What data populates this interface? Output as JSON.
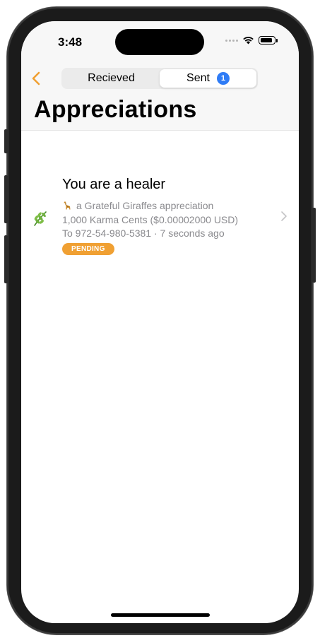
{
  "status_bar": {
    "time": "3:48"
  },
  "nav": {
    "back_icon": "chevron-left-icon",
    "segments": [
      {
        "label": "Recieved",
        "selected": false
      },
      {
        "label": "Sent",
        "selected": true,
        "badge": "1"
      }
    ],
    "title": "Appreciations"
  },
  "colors": {
    "accent": "#f0a033",
    "badge": "#2f7cf6",
    "secondary_text": "#8a8a8e"
  },
  "appreciation": {
    "title": "You are a healer",
    "icon": "leaf-icon",
    "source_icon": "giraffe-icon",
    "source": "a Grateful Giraffes appreciation",
    "amount": "1,000 Karma Cents ($0.00002000 USD)",
    "recipient": "To 972-54-980-5381 · 7 seconds ago",
    "status": "PENDING"
  }
}
